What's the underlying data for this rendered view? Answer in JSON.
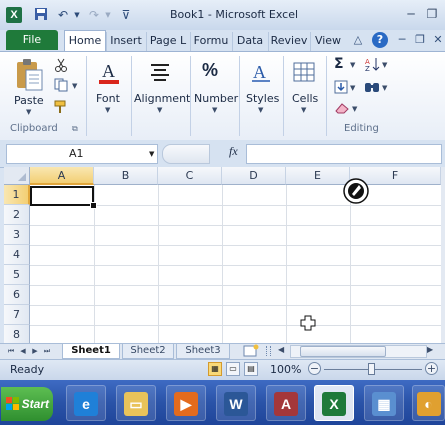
{
  "window": {
    "title": "Book1 - Microsoft Excel",
    "app_icon_letter": "X"
  },
  "quick_access": {
    "icons": [
      "save-icon",
      "undo-icon",
      "redo-icon",
      "customize-icon"
    ]
  },
  "tabs": [
    {
      "label": "File"
    },
    {
      "label": "Home"
    },
    {
      "label": "Insert"
    },
    {
      "label": "Page L"
    },
    {
      "label": "Formu"
    },
    {
      "label": "Data"
    },
    {
      "label": "Reviev"
    },
    {
      "label": "View"
    }
  ],
  "ribbon": {
    "paste_label": "Paste",
    "clipboard_label": "Clipboard",
    "font_label": "Font",
    "alignment_label": "Alignment",
    "number_label": "Number",
    "number_glyph": "%",
    "styles_label": "Styles",
    "cells_label": "Cells",
    "editing_label": "Editing",
    "sigma_glyph": "Σ"
  },
  "formula_bar": {
    "name_box": "A1",
    "fx_label": "fx",
    "value": ""
  },
  "grid": {
    "columns": [
      "A",
      "B",
      "C",
      "D",
      "E",
      "F"
    ],
    "rows": [
      "1",
      "2",
      "3",
      "4",
      "5",
      "6",
      "7",
      "8"
    ],
    "active_cell": "A1"
  },
  "sheets": [
    {
      "label": "Sheet1"
    },
    {
      "label": "Sheet2"
    },
    {
      "label": "Sheet3"
    }
  ],
  "status": {
    "text": "Ready",
    "zoom": "100%",
    "zoom_minus": "−",
    "zoom_plus": "+"
  },
  "taskbar": {
    "start_label": "Start",
    "apps": [
      "ie-icon",
      "file-explorer-icon",
      "media-player-icon",
      "word-icon",
      "access-icon",
      "excel-icon",
      "calculator-icon",
      "paint-icon"
    ]
  },
  "colors": {
    "excel_green": "#1f7a3a",
    "selection_orange": "#f3cf74",
    "taskbar_blue": "#2a53a8"
  }
}
